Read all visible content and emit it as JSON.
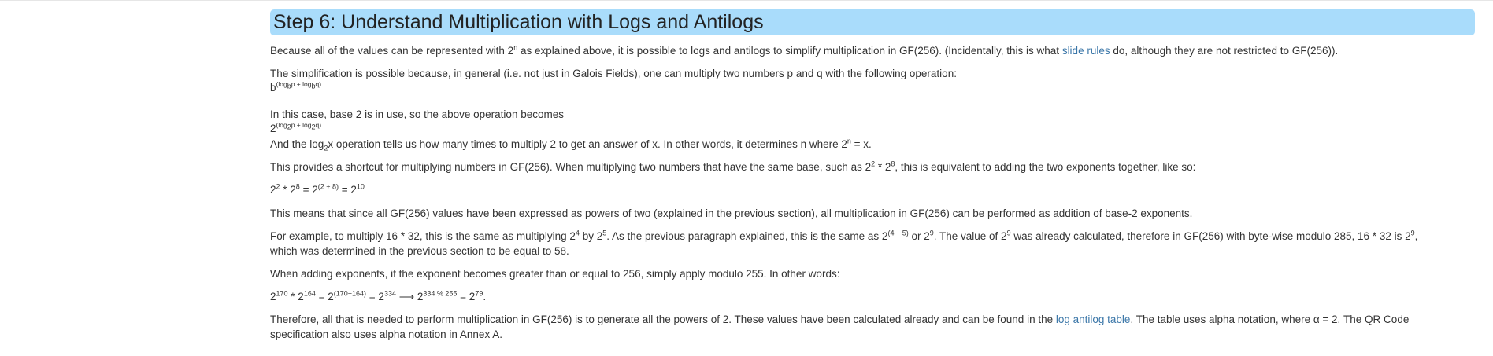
{
  "heading": "Step 6: Understand Multiplication with Logs and Antilogs",
  "p1": {
    "t1": "Because all of the values can be represented with 2",
    "sup": "n",
    "t2": " as explained above, it is possible to logs and antilogs to simplify multiplication in GF(256). (Incidentally, this is what ",
    "link": "slide rules",
    "t3": " do, although they are not restricted to GF(256))."
  },
  "p2": {
    "text": "The simplification is possible because, in general (i.e. not just in Galois Fields), one can multiply two numbers p and q with the following operation:",
    "f_base": "b",
    "f_sup": "(log",
    "f_sub1": "b",
    "f_mid": "p + log",
    "f_sub2": "b",
    "f_end": "q)"
  },
  "p3": {
    "text": "In this case, base 2 is in use, so the above operation becomes",
    "f_base": "2",
    "f_sup": "(log",
    "f_sub1": "2",
    "f_mid": "p + log",
    "f_sub2": "2",
    "f_end": "q)"
  },
  "p4": {
    "t1": "And the log",
    "sub": "2",
    "t2": "x operation tells us how many times to multiply 2 to get an answer of x. In other words, it determines n where 2",
    "sup": "n",
    "t3": " = x."
  },
  "p5": {
    "t1": "This provides a shortcut for multiplying numbers in GF(256). When multiplying two numbers that have the same base, such as 2",
    "sup1": "2",
    "t2": " * 2",
    "sup2": "8",
    "t3": ", this is equivalent to adding the two exponents together, like so:"
  },
  "eq1": {
    "b1": "2",
    "s1": "2",
    "op1": " * 2",
    "s2": "8",
    "eq1": " = 2",
    "s3": "(2 + 8)",
    "eq2": " = 2",
    "s4": "10"
  },
  "p6": "This means that since all GF(256) values have been expressed as powers of two (explained in the previous section), all multiplication in GF(256) can be performed as addition of base-2 exponents.",
  "p7": {
    "t1": "For example, to multiply 16 * 32, this is the same as multiplying 2",
    "s1": "4",
    "t2": " by 2",
    "s2": "5",
    "t3": ". As the previous paragraph explained, this is the same as 2",
    "s3": "(4 + 5)",
    "t4": " or 2",
    "s4": "9",
    "t5": ". The value of 2",
    "s5": "9",
    "t6": " was already calculated, therefore in GF(256) with byte-wise modulo 285, 16 * 32 is 2",
    "s6": "9",
    "t7": ",",
    "t8": "which was determined in the previous section to be equal to 58."
  },
  "p8": "When adding exponents, if the exponent becomes greater than or equal to 256, simply apply modulo 255. In other words:",
  "eq2": {
    "b1": "2",
    "s1": "170",
    "op1": " * 2",
    "s2": "164",
    "eq1": " = 2",
    "s3": "(170+164)",
    "eq2": " = 2",
    "s4": "334",
    "arrow": " ⟶ 2",
    "s5": "334 % 255",
    "eq3": " = 2",
    "s6": "79",
    "end": "."
  },
  "p9": {
    "t1": "Therefore, all that is needed to perform multiplication in GF(256) is to generate all the powers of 2. These values have been calculated already and can be found in the ",
    "link": "log antilog table",
    "t2": ". The table uses alpha notation, where α = 2. The QR Code",
    "t3": "specification also uses alpha notation in Annex A."
  }
}
